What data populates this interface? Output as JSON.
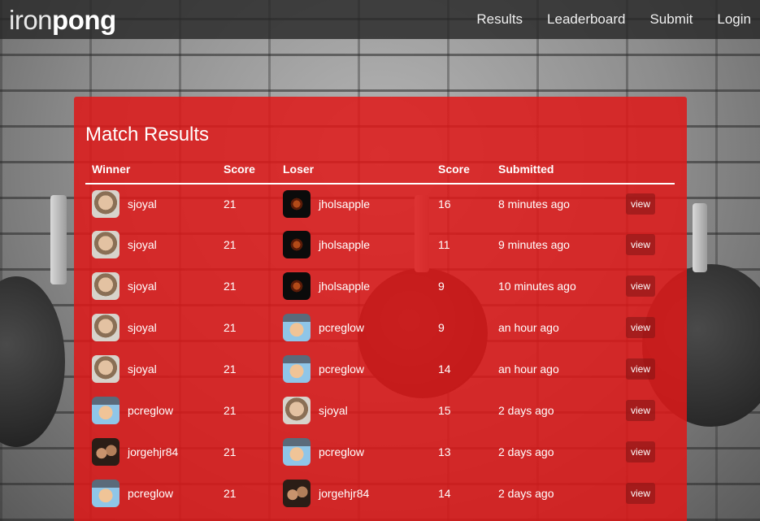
{
  "nav": {
    "brand_light": "iron",
    "brand_bold": "pong",
    "links": [
      "Results",
      "Leaderboard",
      "Submit",
      "Login"
    ]
  },
  "page": {
    "title": "Match Results"
  },
  "table": {
    "headers": [
      "Winner",
      "Score",
      "Loser",
      "Score",
      "Submitted",
      ""
    ],
    "rows": [
      {
        "winner": "sjoyal",
        "winner_score": "21",
        "loser": "jholsapple",
        "loser_score": "16",
        "submitted": "8 minutes ago",
        "action": "view"
      },
      {
        "winner": "sjoyal",
        "winner_score": "21",
        "loser": "jholsapple",
        "loser_score": "11",
        "submitted": "9 minutes ago",
        "action": "view"
      },
      {
        "winner": "sjoyal",
        "winner_score": "21",
        "loser": "jholsapple",
        "loser_score": "9",
        "submitted": "10 minutes ago",
        "action": "view"
      },
      {
        "winner": "sjoyal",
        "winner_score": "21",
        "loser": "pcreglow",
        "loser_score": "9",
        "submitted": "an hour ago",
        "action": "view"
      },
      {
        "winner": "sjoyal",
        "winner_score": "21",
        "loser": "pcreglow",
        "loser_score": "14",
        "submitted": "an hour ago",
        "action": "view"
      },
      {
        "winner": "pcreglow",
        "winner_score": "21",
        "loser": "sjoyal",
        "loser_score": "15",
        "submitted": "2 days ago",
        "action": "view"
      },
      {
        "winner": "jorgehjr84",
        "winner_score": "21",
        "loser": "pcreglow",
        "loser_score": "13",
        "submitted": "2 days ago",
        "action": "view"
      },
      {
        "winner": "pcreglow",
        "winner_score": "21",
        "loser": "jorgehjr84",
        "loser_score": "14",
        "submitted": "2 days ago",
        "action": "view"
      }
    ]
  },
  "colors": {
    "panel": "#de1818",
    "navbar": "#282828"
  }
}
